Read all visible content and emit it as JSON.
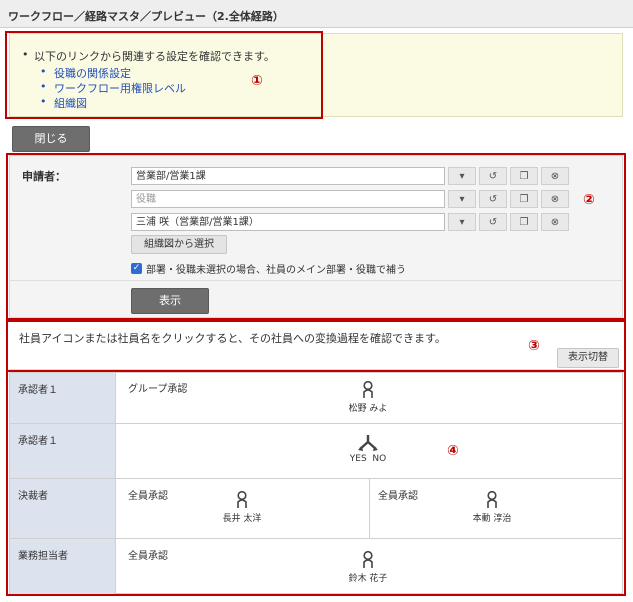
{
  "titlebar": {
    "title": "ワークフロー／経路マスタ／プレビュー（2.全体経路）"
  },
  "info": {
    "bullet": "•",
    "intro": "以下のリンクから関連する設定を確認できます。",
    "links": [
      "役職の関係設定",
      "ワークフロー用権限レベル",
      "組織図"
    ]
  },
  "callouts": [
    "①",
    "②",
    "③",
    "④"
  ],
  "close_button": "閉じる",
  "form": {
    "applicant_label": "申請者：",
    "department_value": "営業部/営業1課",
    "position_placeholder": "役職",
    "employee_value": "三浦 咲（営業部/営業1課）",
    "org_select_button": "組織図から選択",
    "supplement_checkbox": "部署・役職未選択の場合、社員のメイン部署・役職で補う",
    "show_button": "表示"
  },
  "notice": {
    "text": "社員アイコンまたは社員名をクリックすると、その社員への変換過程を確認できます。",
    "toggle_button": "表示切替"
  },
  "route": {
    "rows": [
      {
        "label": "承認者１",
        "type": "グループ承認",
        "person": "松野 みよ"
      },
      {
        "label": "承認者１",
        "branch_yes": "YES",
        "branch_no": "NO"
      },
      {
        "label": "決裁者",
        "type_left": "全員承認",
        "person_left": "長井 太洋",
        "type_right": "全員承認",
        "person_right": "本動 淳治"
      },
      {
        "label": "業務担当者",
        "type": "全員承認",
        "person": "鈴木 花子"
      }
    ]
  },
  "colors": {
    "accent_red": "#c00000",
    "link_blue": "#1f4fb8",
    "row_header": "#dde3ee"
  }
}
